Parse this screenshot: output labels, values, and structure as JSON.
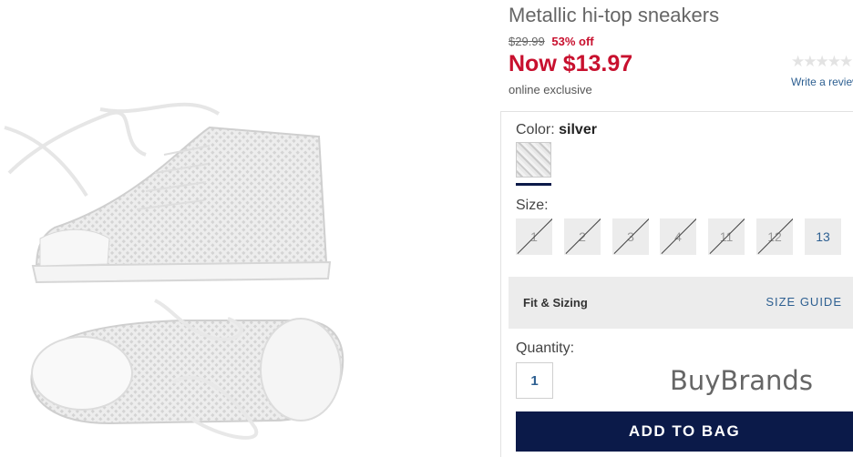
{
  "product": {
    "title": "Metallic hi-top sneakers",
    "was_price": "$29.99",
    "discount": "53% off",
    "now_price": "Now $13.97",
    "exclusive": "online exclusive"
  },
  "reviews": {
    "stars": "★★★★★",
    "rating": 0,
    "write_review_label": "Write a review"
  },
  "color": {
    "label": "Color:",
    "selected": "silver",
    "swatches": [
      {
        "name": "silver",
        "selected": true
      }
    ]
  },
  "sizes": {
    "label": "Size:",
    "options": [
      {
        "label": "1",
        "available": false
      },
      {
        "label": "2",
        "available": false
      },
      {
        "label": "3",
        "available": false
      },
      {
        "label": "4",
        "available": false
      },
      {
        "label": "11",
        "available": false
      },
      {
        "label": "12",
        "available": false
      },
      {
        "label": "13",
        "available": true
      }
    ]
  },
  "fit": {
    "title": "Fit & Sizing",
    "guide_label": "SIZE GUIDE"
  },
  "quantity": {
    "label": "Quantity:",
    "value": "1"
  },
  "watermark": "BuyBrands",
  "add_to_bag_label": "ADD TO BAG",
  "colors": {
    "sale_red": "#c8102e",
    "navy": "#0b1a49",
    "link_blue": "#2d5f91"
  }
}
